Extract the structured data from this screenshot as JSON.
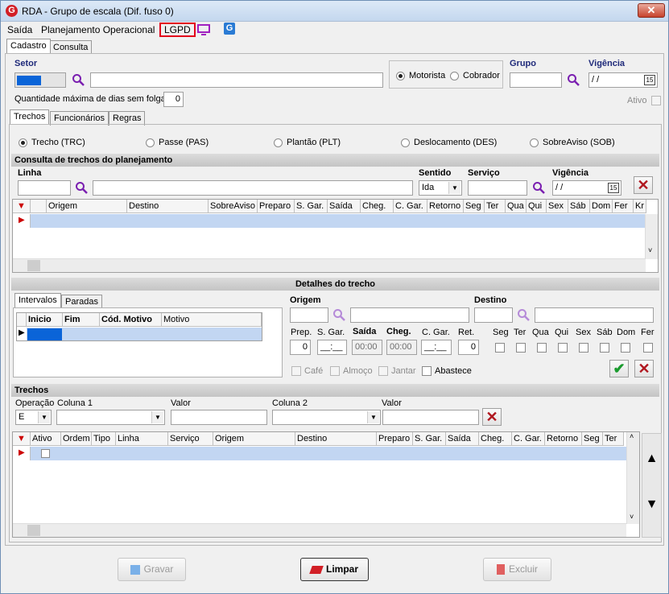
{
  "window": {
    "title": "RDA - Grupo de escala (Dif. fuso 0)",
    "close": "✕"
  },
  "menu": {
    "items": [
      "Saída",
      "Planejamento Operacional",
      "LGPD"
    ]
  },
  "main_tabs": [
    "Cadastro",
    "Consulta"
  ],
  "setor": {
    "label": "Setor",
    "value": ""
  },
  "tipo": {
    "motorista": "Motorista",
    "cobrador": "Cobrador"
  },
  "grupo": {
    "label": "Grupo",
    "value": ""
  },
  "vigencia": {
    "label": "Vigência",
    "value": " /  /"
  },
  "qtd_max": {
    "label": "Quantidade máxima de dias sem folga",
    "value": "0"
  },
  "ativo": {
    "label": "Ativo"
  },
  "sub_tabs": [
    "Trechos",
    "Funcionários",
    "Regras"
  ],
  "trecho_types": [
    "Trecho (TRC)",
    "Passe (PAS)",
    "Plantão (PLT)",
    "Deslocamento (DES)",
    "SobreAviso (SOB)"
  ],
  "consulta": {
    "title": "Consulta de trechos do planejamento",
    "linha_label": "Linha",
    "sentido_label": "Sentido",
    "sentido_value": "Ida",
    "servico_label": "Serviço",
    "vigencia_label": "Vigência",
    "vigencia_value": " /  /",
    "columns": [
      "Origem",
      "Destino",
      "SobreAviso",
      "Preparo",
      "S. Gar.",
      "Saída",
      "Cheg.",
      "C. Gar.",
      "Retorno",
      "Seg",
      "Ter",
      "Qua",
      "Qui",
      "Sex",
      "Sáb",
      "Dom",
      "Fer",
      "Kr"
    ]
  },
  "detalhes": {
    "title": "Detalhes do trecho",
    "tabs": [
      "Intervalos",
      "Paradas"
    ],
    "columns": [
      "Inicio",
      "Fim",
      "Cód. Motivo",
      "Motivo"
    ],
    "origem_label": "Origem",
    "destino_label": "Destino",
    "prep_label": "Prep.",
    "sgar_label": "S. Gar.",
    "saida_label": "Saída",
    "cheg_label": "Cheg.",
    "cgar_label": "C. Gar.",
    "ret_label": "Ret.",
    "prep_value": "0",
    "sgar_value": "__:__",
    "saida_value": "00:00",
    "cheg_value": "00:00",
    "cgar_value": "__:__",
    "ret_value": "0",
    "days": [
      "Seg",
      "Ter",
      "Qua",
      "Qui",
      "Sex",
      "Sáb",
      "Dom",
      "Fer"
    ],
    "meals": [
      "Café",
      "Almoço",
      "Jantar",
      "Abastece"
    ]
  },
  "trechos": {
    "title": "Trechos",
    "op_label": "Operação",
    "col1_label": "Coluna 1",
    "valor_label": "Valor",
    "col2_label": "Coluna 2",
    "valor2_label": "Valor",
    "op_value": "E",
    "columns": [
      "Ativo",
      "Ordem",
      "Tipo",
      "Linha",
      "Serviço",
      "Origem",
      "Destino",
      "Preparo",
      "S. Gar.",
      "Saída",
      "Cheg.",
      "C. Gar.",
      "Retorno",
      "Seg",
      "Ter"
    ]
  },
  "buttons": {
    "gravar": "Gravar",
    "limpar": "Limpar",
    "excluir": "Excluir"
  },
  "colors": {
    "accent": "#0a64d8",
    "lgpd_border": "#e3001b",
    "ok_green": "#1a9b2e",
    "x_red": "#b0171f"
  }
}
